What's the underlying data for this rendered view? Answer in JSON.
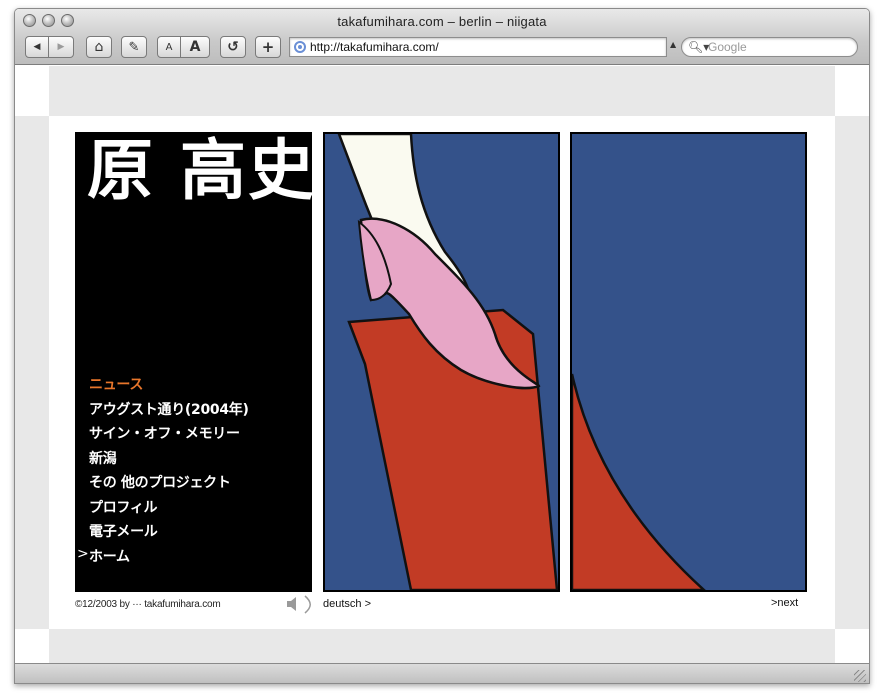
{
  "window": {
    "title": "takafumihara.com – berlin – niigata"
  },
  "toolbar": {
    "back_label": "◀",
    "forward_label": "▶",
    "home_label": "⌂",
    "edit_label": "✎",
    "text_small_label": "A",
    "text_large_label": "A",
    "reload_label": "↺",
    "add_bookmark_label": "+"
  },
  "address_bar": {
    "url": "http://takafumihara.com/"
  },
  "search": {
    "placeholder": "Google",
    "icon": "search-icon"
  },
  "site": {
    "name_kanji": "原 高史",
    "menu": [
      {
        "label": "ニュース",
        "active": true
      },
      {
        "label": "アウグスト通り(2004年)",
        "active": false
      },
      {
        "label": "サイン・オフ・メモリー",
        "active": false
      },
      {
        "label": "新潟",
        "active": false
      },
      {
        "label": "その 他のプロジェクト",
        "active": false
      },
      {
        "label": "プロフィル",
        "active": false
      },
      {
        "label": "電子メール",
        "active": false
      },
      {
        "label": "ホーム",
        "active": false
      }
    ],
    "menu_arrow": ">",
    "copyright": "©12/2003 by ··· takafumihara.com",
    "language_link": "deutsch >",
    "next_link": ">next"
  },
  "colors": {
    "accent_menu": "#e8762b",
    "painting_blue": "#34528a",
    "painting_red": "#c23b25",
    "painting_pink": "#e7a6c6"
  }
}
